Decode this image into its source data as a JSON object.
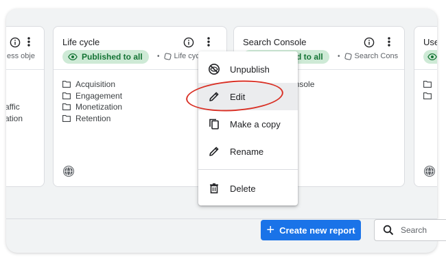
{
  "cards": [
    {
      "title": "",
      "meta_text": "ess obje",
      "folders": [
        "affic",
        "ation"
      ]
    },
    {
      "title": "Life cycle",
      "status": "Published to all",
      "meta_text": "Life cycle",
      "folders": [
        "Acquisition",
        "Engagement",
        "Monetization",
        "Retention"
      ]
    },
    {
      "title": "Search Console",
      "status": "Published to all",
      "meta_text": "Search Cons",
      "folders": [
        "Search Console"
      ]
    },
    {
      "title": "Use"
    }
  ],
  "context_menu": {
    "items": [
      {
        "label": "Unpublish",
        "icon": "unpublish-icon"
      },
      {
        "label": "Edit",
        "icon": "pencil-icon"
      },
      {
        "label": "Make a copy",
        "icon": "copy-icon"
      },
      {
        "label": "Rename",
        "icon": "pencil-icon"
      },
      {
        "label": "Delete",
        "icon": "trash-icon"
      }
    ],
    "highlighted": "Edit"
  },
  "footer": {
    "create_label": "Create new report",
    "search_placeholder": "Search"
  },
  "colors": {
    "accent": "#1a73e8",
    "published_bg": "#ceead6",
    "published_text": "#137333",
    "annotation": "#d93025"
  }
}
